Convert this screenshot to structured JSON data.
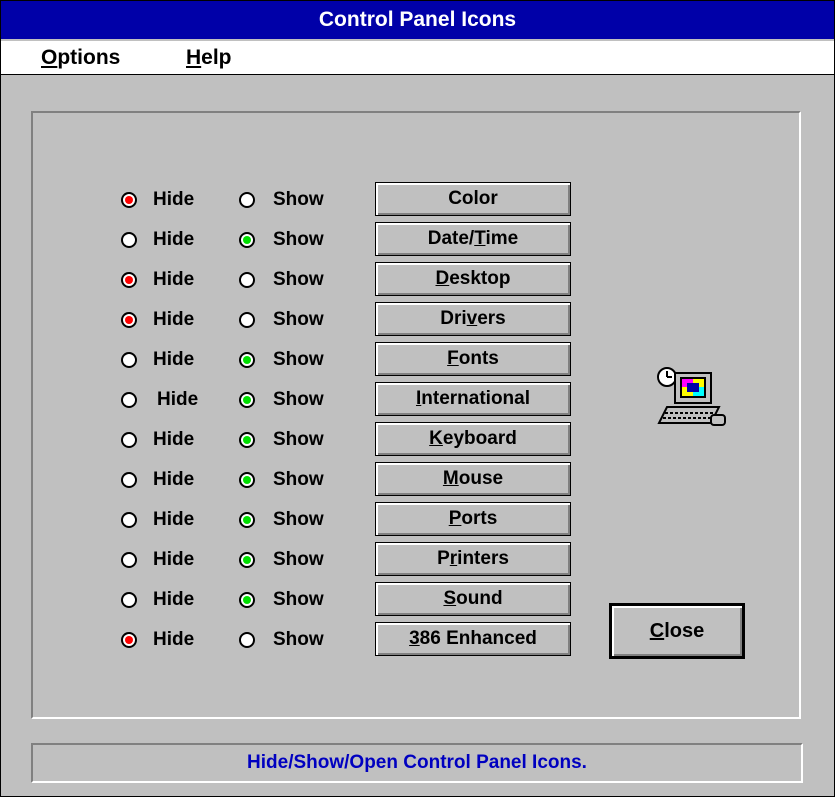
{
  "window": {
    "title": "Control Panel Icons"
  },
  "menu": {
    "options": {
      "mnemonic": "O",
      "rest": "ptions"
    },
    "help": {
      "mnemonic": "H",
      "rest": "elp"
    }
  },
  "radio_labels": {
    "hide": "Hide",
    "show": "Show"
  },
  "items": [
    {
      "pre": "C",
      "ul": "",
      "post": "olor",
      "state": "hide"
    },
    {
      "pre": "Date/",
      "ul": "T",
      "post": "ime",
      "state": "show"
    },
    {
      "pre": "",
      "ul": "D",
      "post": "esktop",
      "state": "hide"
    },
    {
      "pre": "Dri",
      "ul": "v",
      "post": "ers",
      "state": "hide"
    },
    {
      "pre": "",
      "ul": "F",
      "post": "onts",
      "state": "show"
    },
    {
      "pre": "",
      "ul": "I",
      "post": "nternational",
      "state": "show"
    },
    {
      "pre": "",
      "ul": "K",
      "post": "eyboard",
      "state": "show"
    },
    {
      "pre": "",
      "ul": "M",
      "post": "ouse",
      "state": "show"
    },
    {
      "pre": "",
      "ul": "P",
      "post": "orts",
      "state": "show"
    },
    {
      "pre": "P",
      "ul": "r",
      "post": "inters",
      "state": "show"
    },
    {
      "pre": "",
      "ul": "S",
      "post": "ound",
      "state": "show"
    },
    {
      "pre": "",
      "ul": "3",
      "post": "86 Enhanced",
      "state": "hide"
    }
  ],
  "close_button": {
    "mnemonic": "C",
    "rest": "lose"
  },
  "status": {
    "text": "Hide/Show/Open Control Panel Icons."
  },
  "icons": {
    "app": "control-panel-computer-icon"
  },
  "colors": {
    "title_bar": "#0000a8",
    "hide_selected": "#ff0000",
    "show_selected": "#00e000",
    "status_text": "#0000c0",
    "face": "#c0c0c0"
  }
}
